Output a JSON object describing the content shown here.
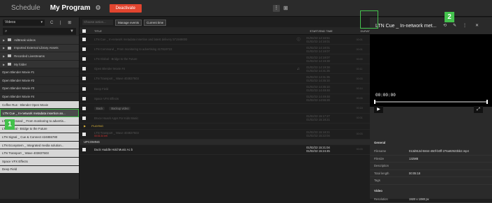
{
  "topbar": {
    "schedule": "Schedule",
    "program": "My Program",
    "gear": "⚙",
    "deactivate": "Deactivate",
    "icon1": "⋮",
    "icon2": "⊞"
  },
  "sidebar": {
    "select": "Videos",
    "select_arrow": "▾",
    "tools": "C | ⊞",
    "search_icon": "⌕",
    "filter_icon": "▼",
    "items": [
      {
        "label": "AdBreak videos",
        "kind": "folder"
      },
      {
        "label": "Imported External Library Assets",
        "kind": "folder"
      },
      {
        "label": "Recorded Livestreams",
        "kind": "folder"
      },
      {
        "label": "My folder",
        "kind": "folder"
      },
      {
        "label": "Open Blender Movie #1",
        "kind": "file"
      },
      {
        "label": "Open Blender Movie #2",
        "kind": "file"
      },
      {
        "label": "Open Blender Movie #3",
        "kind": "file"
      },
      {
        "label": "Open Blender Movie #4",
        "kind": "file"
      },
      {
        "label": "Coffee Run - Blender Open Movie",
        "kind": "light"
      },
      {
        "label": "LTN Cue _ In-network metadata insertion an...",
        "kind": "selected"
      },
      {
        "label": "LTN Command _ From monitoring to advertis...",
        "kind": "light"
      },
      {
        "label": "LTN Global - Bridge to the Future",
        "kind": "light"
      },
      {
        "label": "LTN Signal _ Cue & Connect 424855780",
        "kind": "light"
      },
      {
        "label": "LTN Ecosystem _ Integrated media solution...",
        "kind": "light"
      },
      {
        "label": "LTN Transport _ Wave 403837503",
        "kind": "light"
      },
      {
        "label": "Space VFX Effects",
        "kind": "light"
      },
      {
        "label": "Deep Field",
        "kind": "light"
      }
    ]
  },
  "main": {
    "actions_placeholder": "Choose action...",
    "actions_arrow": "▾",
    "manage_events": "Manage events",
    "current_time": "Current time",
    "col_title": "TITLE",
    "col_time": "START/END TIME",
    "col_dur": "DURAT",
    "rows": [
      {
        "title": "LTN Cue _ In-network metadata insertion and latest delivery 571949000",
        "time1": "01/02/22 14:16:51",
        "time2": "01/02/22 14:18:01",
        "dur": "00:01",
        "icon": "ⓘ",
        "style": "dim"
      },
      {
        "title": "LTN Command _ From monitoring to advertising 417619723",
        "time1": "01/02/22 14:18:01",
        "time2": "01/02/22 14:19:07",
        "dur": "00:01",
        "icon": "",
        "style": "dim"
      },
      {
        "title": "LTN Global - Bridge to the Future",
        "time1": "01/02/22 14:19:07",
        "time2": "01/02/22 14:19:38",
        "dur": "00:00",
        "icon": "",
        "style": "dim"
      },
      {
        "title": "Open Blender Movie #4",
        "time1": "01/02/22 14:19:38",
        "time2": "01/02/22 14:31:35",
        "dur": "00:11",
        "icon": "♫",
        "style": "dim"
      },
      {
        "title": "LTN Transport _ Wave 403837503",
        "time1": "01/02/22 14:31:35",
        "time2": "01/02/22 14:35:10",
        "dur": "00:03",
        "icon": "",
        "style": "dim"
      },
      {
        "title": "Deep Field",
        "time1": "01/02/22 14:35:10",
        "time2": "01/02/22 14:49:48",
        "dur": "00:14",
        "icon": "",
        "style": "dim"
      },
      {
        "title": "Space VFX Effects",
        "time1": "01/02/22 14:49:48",
        "time2": "01/02/22 14:55:28",
        "dur": "00:05",
        "icon": "",
        "style": "dim"
      },
      {
        "title": "Backup video",
        "pill": "Back",
        "time1": "",
        "time2": "",
        "dur": "00:18",
        "icon": "",
        "style": "pill"
      },
      {
        "title": "Bruce Haack Apps For Kids Music",
        "time1": "01/02/22 15:17:27",
        "time2": "01/02/22 15:18:21",
        "dur": "00:01",
        "icon": "",
        "style": "dim"
      }
    ],
    "playing_label": "PLAYING",
    "playing_row": {
      "title": "LTN Transport _ Wave 403837503",
      "sub": "00:01:34 left",
      "time1": "01/02/22 15:18:21",
      "time2": "01/02/22 15:22:04",
      "dur": "00:03"
    },
    "upcoming_label": "UPCOMING",
    "upcoming_row": {
      "title": "Duck Huddle Hold Music Ac b",
      "time1": "01/02/22 15:21:04",
      "time2": "01/02/22 15:24:45",
      "dur": "00:03"
    }
  },
  "panel": {
    "title": "LTN Cue _ In-network met...",
    "icon_a": "⟲",
    "icon_edit": "✎",
    "icon_more": "⋮",
    "icon_close": "✕",
    "timecode": "00:00:00",
    "play": "▶",
    "expand": "⤢",
    "general_label": "General",
    "general": [
      {
        "k": "Filename",
        "v": "013d912d-5844-450f-b0ff-276a92923bb2.mp4"
      },
      {
        "k": "Filesize",
        "v": "132MB"
      },
      {
        "k": "Description",
        "v": ""
      },
      {
        "k": "Total length",
        "v": "00:05:18"
      },
      {
        "k": "Tags",
        "v": ""
      }
    ],
    "video_label": "Video",
    "video": [
      {
        "k": "Resolution",
        "v": "1920 x 1080 px"
      }
    ]
  },
  "annotations": {
    "badge1": "1",
    "badge2": "2"
  },
  "colors": {
    "accent_green": "#44c24d",
    "deactivate_red": "#e2452f",
    "playing_yellow": "#e2b93b"
  }
}
